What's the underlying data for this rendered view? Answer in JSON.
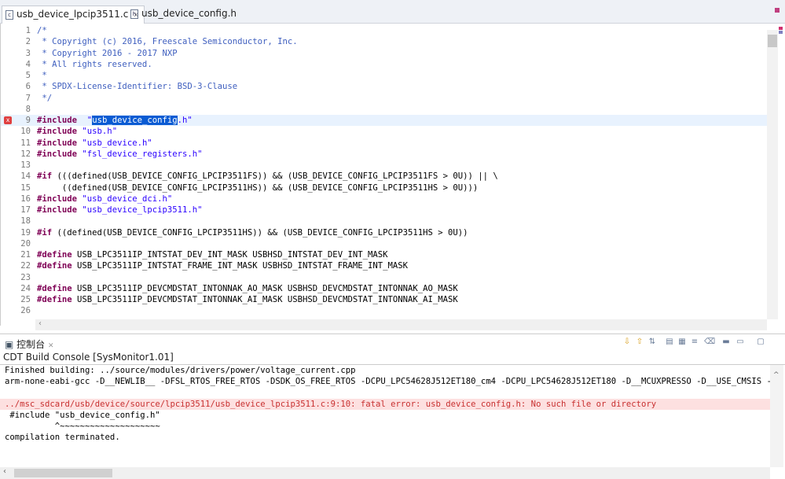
{
  "tabs": [
    {
      "label": "usb_device_lpcip3511.c",
      "icon": "c-file-icon",
      "active": true
    },
    {
      "label": "usb_device_config.h",
      "icon": "h-file-icon",
      "active": false
    }
  ],
  "code": [
    {
      "n": "1",
      "t": [
        [
          "cm",
          "/*"
        ]
      ]
    },
    {
      "n": "2",
      "t": [
        [
          "cm",
          " * Copyright (c) 2016, Freescale Semiconductor, Inc."
        ]
      ]
    },
    {
      "n": "3",
      "t": [
        [
          "cm",
          " * Copyright 2016 - 2017 NXP"
        ]
      ]
    },
    {
      "n": "4",
      "t": [
        [
          "cm",
          " * All rights reserved."
        ]
      ]
    },
    {
      "n": "5",
      "t": [
        [
          "cm",
          " *"
        ]
      ]
    },
    {
      "n": "6",
      "t": [
        [
          "cm",
          " * SPDX-License-Identifier: BSD-3-Clause"
        ]
      ]
    },
    {
      "n": "7",
      "t": [
        [
          "cm",
          " */"
        ]
      ]
    },
    {
      "n": "8",
      "t": []
    },
    {
      "n": "9",
      "t": [
        [
          "kw",
          "#include"
        ],
        [
          "",
          "  "
        ],
        [
          "st",
          "\""
        ],
        [
          "sel",
          "usb_device_config"
        ],
        [
          "st",
          ".h\""
        ]
      ],
      "error": true,
      "current": true
    },
    {
      "n": "10",
      "t": [
        [
          "kw",
          "#include"
        ],
        [
          "",
          " "
        ],
        [
          "st",
          "\"usb.h\""
        ]
      ]
    },
    {
      "n": "11",
      "t": [
        [
          "kw",
          "#include"
        ],
        [
          "",
          " "
        ],
        [
          "st",
          "\"usb_device.h\""
        ]
      ]
    },
    {
      "n": "12",
      "t": [
        [
          "kw",
          "#include"
        ],
        [
          "",
          " "
        ],
        [
          "st",
          "\"fsl_device_registers.h\""
        ]
      ]
    },
    {
      "n": "13",
      "t": []
    },
    {
      "n": "14",
      "t": [
        [
          "kw",
          "#if"
        ],
        [
          "",
          " (((defined(USB_DEVICE_CONFIG_LPCIP3511FS)) && (USB_DEVICE_CONFIG_LPCIP3511FS > 0U)) || \\"
        ]
      ]
    },
    {
      "n": "15",
      "t": [
        [
          "",
          "     ((defined(USB_DEVICE_CONFIG_LPCIP3511HS)) && (USB_DEVICE_CONFIG_LPCIP3511HS > 0U)))"
        ]
      ]
    },
    {
      "n": "16",
      "t": [
        [
          "kw",
          "#include"
        ],
        [
          "",
          " "
        ],
        [
          "st",
          "\"usb_device_dci.h\""
        ]
      ]
    },
    {
      "n": "17",
      "t": [
        [
          "kw",
          "#include"
        ],
        [
          "",
          " "
        ],
        [
          "st",
          "\"usb_device_lpcip3511.h\""
        ]
      ]
    },
    {
      "n": "18",
      "t": []
    },
    {
      "n": "19",
      "t": [
        [
          "kw",
          "#if"
        ],
        [
          "",
          " ((defined(USB_DEVICE_CONFIG_LPCIP3511HS)) && (USB_DEVICE_CONFIG_LPCIP3511HS > 0U))"
        ]
      ]
    },
    {
      "n": "20",
      "t": []
    },
    {
      "n": "21",
      "t": [
        [
          "kw",
          "#define"
        ],
        [
          "",
          " USB_LPC3511IP_INTSTAT_DEV_INT_MASK USBHSD_INTSTAT_DEV_INT_MASK"
        ]
      ]
    },
    {
      "n": "22",
      "t": [
        [
          "kw",
          "#define"
        ],
        [
          "",
          " USB_LPC3511IP_INTSTAT_FRAME_INT_MASK USBHSD_INTSTAT_FRAME_INT_MASK"
        ]
      ]
    },
    {
      "n": "23",
      "t": []
    },
    {
      "n": "24",
      "t": [
        [
          "kw",
          "#define"
        ],
        [
          "",
          " USB_LPC3511IP_DEVCMDSTAT_INTONNAK_AO_MASK USBHSD_DEVCMDSTAT_INTONNAK_AO_MASK"
        ]
      ]
    },
    {
      "n": "25",
      "t": [
        [
          "kw",
          "#define"
        ],
        [
          "",
          " USB_LPC3511IP_DEVCMDSTAT_INTONNAK_AI_MASK USBHSD_DEVCMDSTAT_INTONNAK_AI_MASK"
        ]
      ]
    },
    {
      "n": "26",
      "t": []
    }
  ],
  "console": {
    "tab_label": "控制台",
    "title": "CDT Build Console [SysMonitor1.01]",
    "lines": [
      {
        "text": "Finished building: ../source/modules/drivers/power/voltage_current.cpp",
        "type": "normal"
      },
      {
        "text": "arm-none-eabi-gcc -D__NEWLIB__ -DFSL_RTOS_FREE_RTOS -DSDK_OS_FREE_RTOS -DCPU_LPC54628J512ET180_cm4 -DCPU_LPC54628J512ET180 -D__MCUXPRESSO -D__USE_CMSIS -",
        "type": "normal"
      },
      {
        "text": "",
        "type": "normal"
      },
      {
        "text": "../msc_sdcard/usb/device/source/lpcip3511/usb_device_lpcip3511.c:9:10: fatal error: usb_device_config.h: No such file or directory",
        "type": "error"
      },
      {
        "text": " #include \"usb_device_config.h\"",
        "type": "normal"
      },
      {
        "text": "          ^~~~~~~~~~~~~~~~~~~~~",
        "type": "normal"
      },
      {
        "text": "compilation terminated.",
        "type": "normal"
      }
    ],
    "toolbar": [
      "scroll-down-icon",
      "scroll-up-icon",
      "scroll-lock-icon",
      "show-console-icon",
      "pin-icon",
      "word-wrap-icon",
      "clear-console-icon",
      "open-console-icon",
      "display-console-icon",
      "new-console-icon"
    ]
  },
  "colors": {
    "keyword": "#7f0055",
    "string": "#2a00ff",
    "comment": "#3f5fbf",
    "error": "#c83030",
    "selection": "#0a5bd3"
  }
}
